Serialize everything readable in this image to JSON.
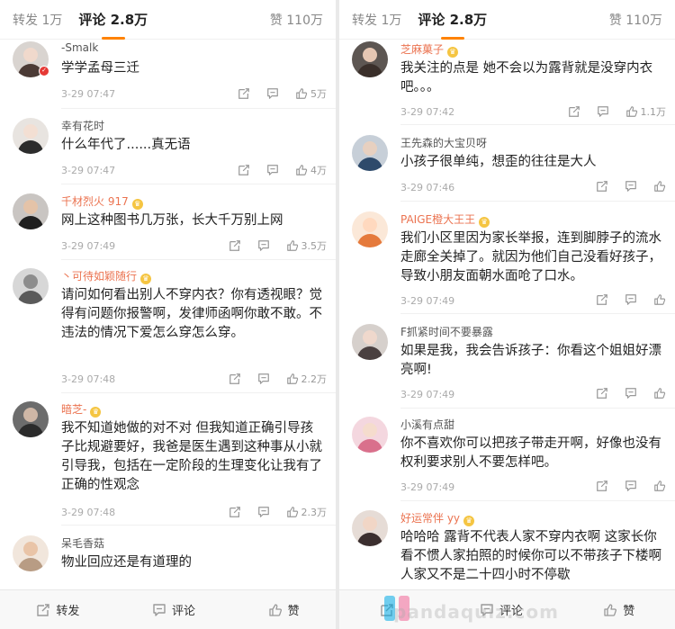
{
  "colors": {
    "accent": "#ff8200",
    "orange_name": "#eb7350",
    "vip_badge": "#e53935"
  },
  "icons": {
    "repost": "share-box-icon",
    "comment": "comment-bubble-icon",
    "like": "thumbs-up-icon",
    "crown": "crown-badge-icon"
  },
  "left": {
    "tabs": {
      "repost": "转发 1万",
      "comments": "评论 2.8万",
      "likes": "赞 110万"
    },
    "comments": [
      {
        "name": "-Smalk",
        "text": "学学孟母三迁",
        "time": "3-29 07:47",
        "likes": "5万"
      },
      {
        "name": "幸有花时",
        "text": "什么年代了......真无语",
        "time": "3-29 07:47",
        "likes": "4万"
      },
      {
        "name": "千材烈火 917",
        "text": "网上这种图书几万张，长大千万别上网",
        "time": "3-29 07:49",
        "likes": "3.5万"
      },
      {
        "name": "丶可待如颖随行",
        "text": "请问如何看出别人不穿内衣？你有透视眼？觉得有问题你报警啊，发律师函啊你敢不敢。不违法的情况下爱怎么穿怎么穿。",
        "time": "3-29 07:48",
        "likes": "2.2万"
      },
      {
        "name": "暗芝-",
        "text": "我不知道她做的对不对 但我知道正确引导孩子比规避要好，我爸是医生遇到这种事从小就引导我，包括在一定阶段的生理变化让我有了正确的性观念",
        "time": "3-29 07:48",
        "likes": "2.3万"
      },
      {
        "name": "呆毛香菇",
        "text": "物业回应还是有道理的"
      }
    ],
    "bottom": {
      "repost": "转发",
      "comment": "评论",
      "like": "赞"
    }
  },
  "right": {
    "tabs": {
      "repost": "转发 1万",
      "comments": "评论 2.8万",
      "likes": "赞 110万"
    },
    "comments": [
      {
        "name": "芝麻菓子",
        "text": "我关注的点是 她不会以为露背就是没穿内衣吧。。。",
        "time": "3-29 07:42",
        "likes": "1.1万"
      },
      {
        "name": "王先森的大宝贝呀",
        "text": "小孩子很单纯，想歪的往往是大人",
        "time": "3-29 07:46"
      },
      {
        "name": "PAIGE橙大王王",
        "text": "我们小区里因为家长举报，连到脚脖子的流水走廊全关掉了。就因为他们自己没看好孩子，导致小朋友面朝水面呛了口水。",
        "time": "3-29 07:49"
      },
      {
        "name": "F抓紧时间不要暴露",
        "text": "如果是我，我会告诉孩子：你看这个姐姐好漂亮啊!",
        "time": "3-29 07:49"
      },
      {
        "name": "小溪有点甜",
        "text": "你不喜欢你可以把孩子带走开啊，好像也没有权利要求别人不要怎样吧。",
        "time": "3-29 07:49"
      },
      {
        "name": "好运常伴 yy",
        "text": "哈哈哈 露背不代表人家不穿内衣啊 这家长你看不惯人家拍照的时候你可以不带孩子下楼啊 人家又不是二十四小时不停歇"
      }
    ],
    "bottom": {
      "comment": "评论",
      "like": "赞"
    },
    "watermark": "pandaquiz.com"
  }
}
